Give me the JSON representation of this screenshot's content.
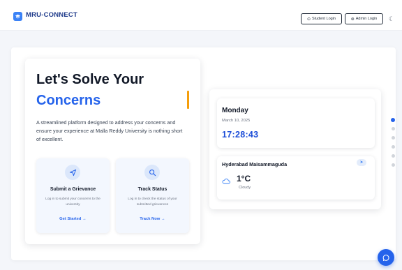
{
  "brand": {
    "name": "MRU-CONNECT",
    "logo_icon": "graduation-icon",
    "accent_color": "#2563eb"
  },
  "header": {
    "student_login_label": "Student Login",
    "student_login_icon": "user-icon",
    "admin_login_label": "Admin Login",
    "admin_login_icon": "shield-icon",
    "theme_icon": "moon-icon"
  },
  "hero": {
    "title_line1": "Let's Solve Your",
    "title_line2": "Concerns",
    "description": "A streamlined platform designed to address your concerns and ensure your experience at Malla Reddy University is nothing short of excellent."
  },
  "actions": [
    {
      "icon": "send-icon",
      "title": "Submit a Grievance",
      "description": "Log in to submit your concerns to the university",
      "link_label": "Get Started →"
    },
    {
      "icon": "search-icon",
      "title": "Track Status",
      "description": "Log in to check the status of your submitted grievances",
      "link_label": "Track Now →"
    }
  ],
  "clock": {
    "day": "Monday",
    "date": "March 10, 2025",
    "time": "17:28:43"
  },
  "weather": {
    "location": "Hyderabad Maisammaguda",
    "location_icon": "navigation-icon",
    "icon": "cloud-icon",
    "temperature": "1°C",
    "condition": "Cloudy"
  },
  "pagination": {
    "total": 6,
    "active": 1
  },
  "chat": {
    "icon": "chat-icon"
  }
}
